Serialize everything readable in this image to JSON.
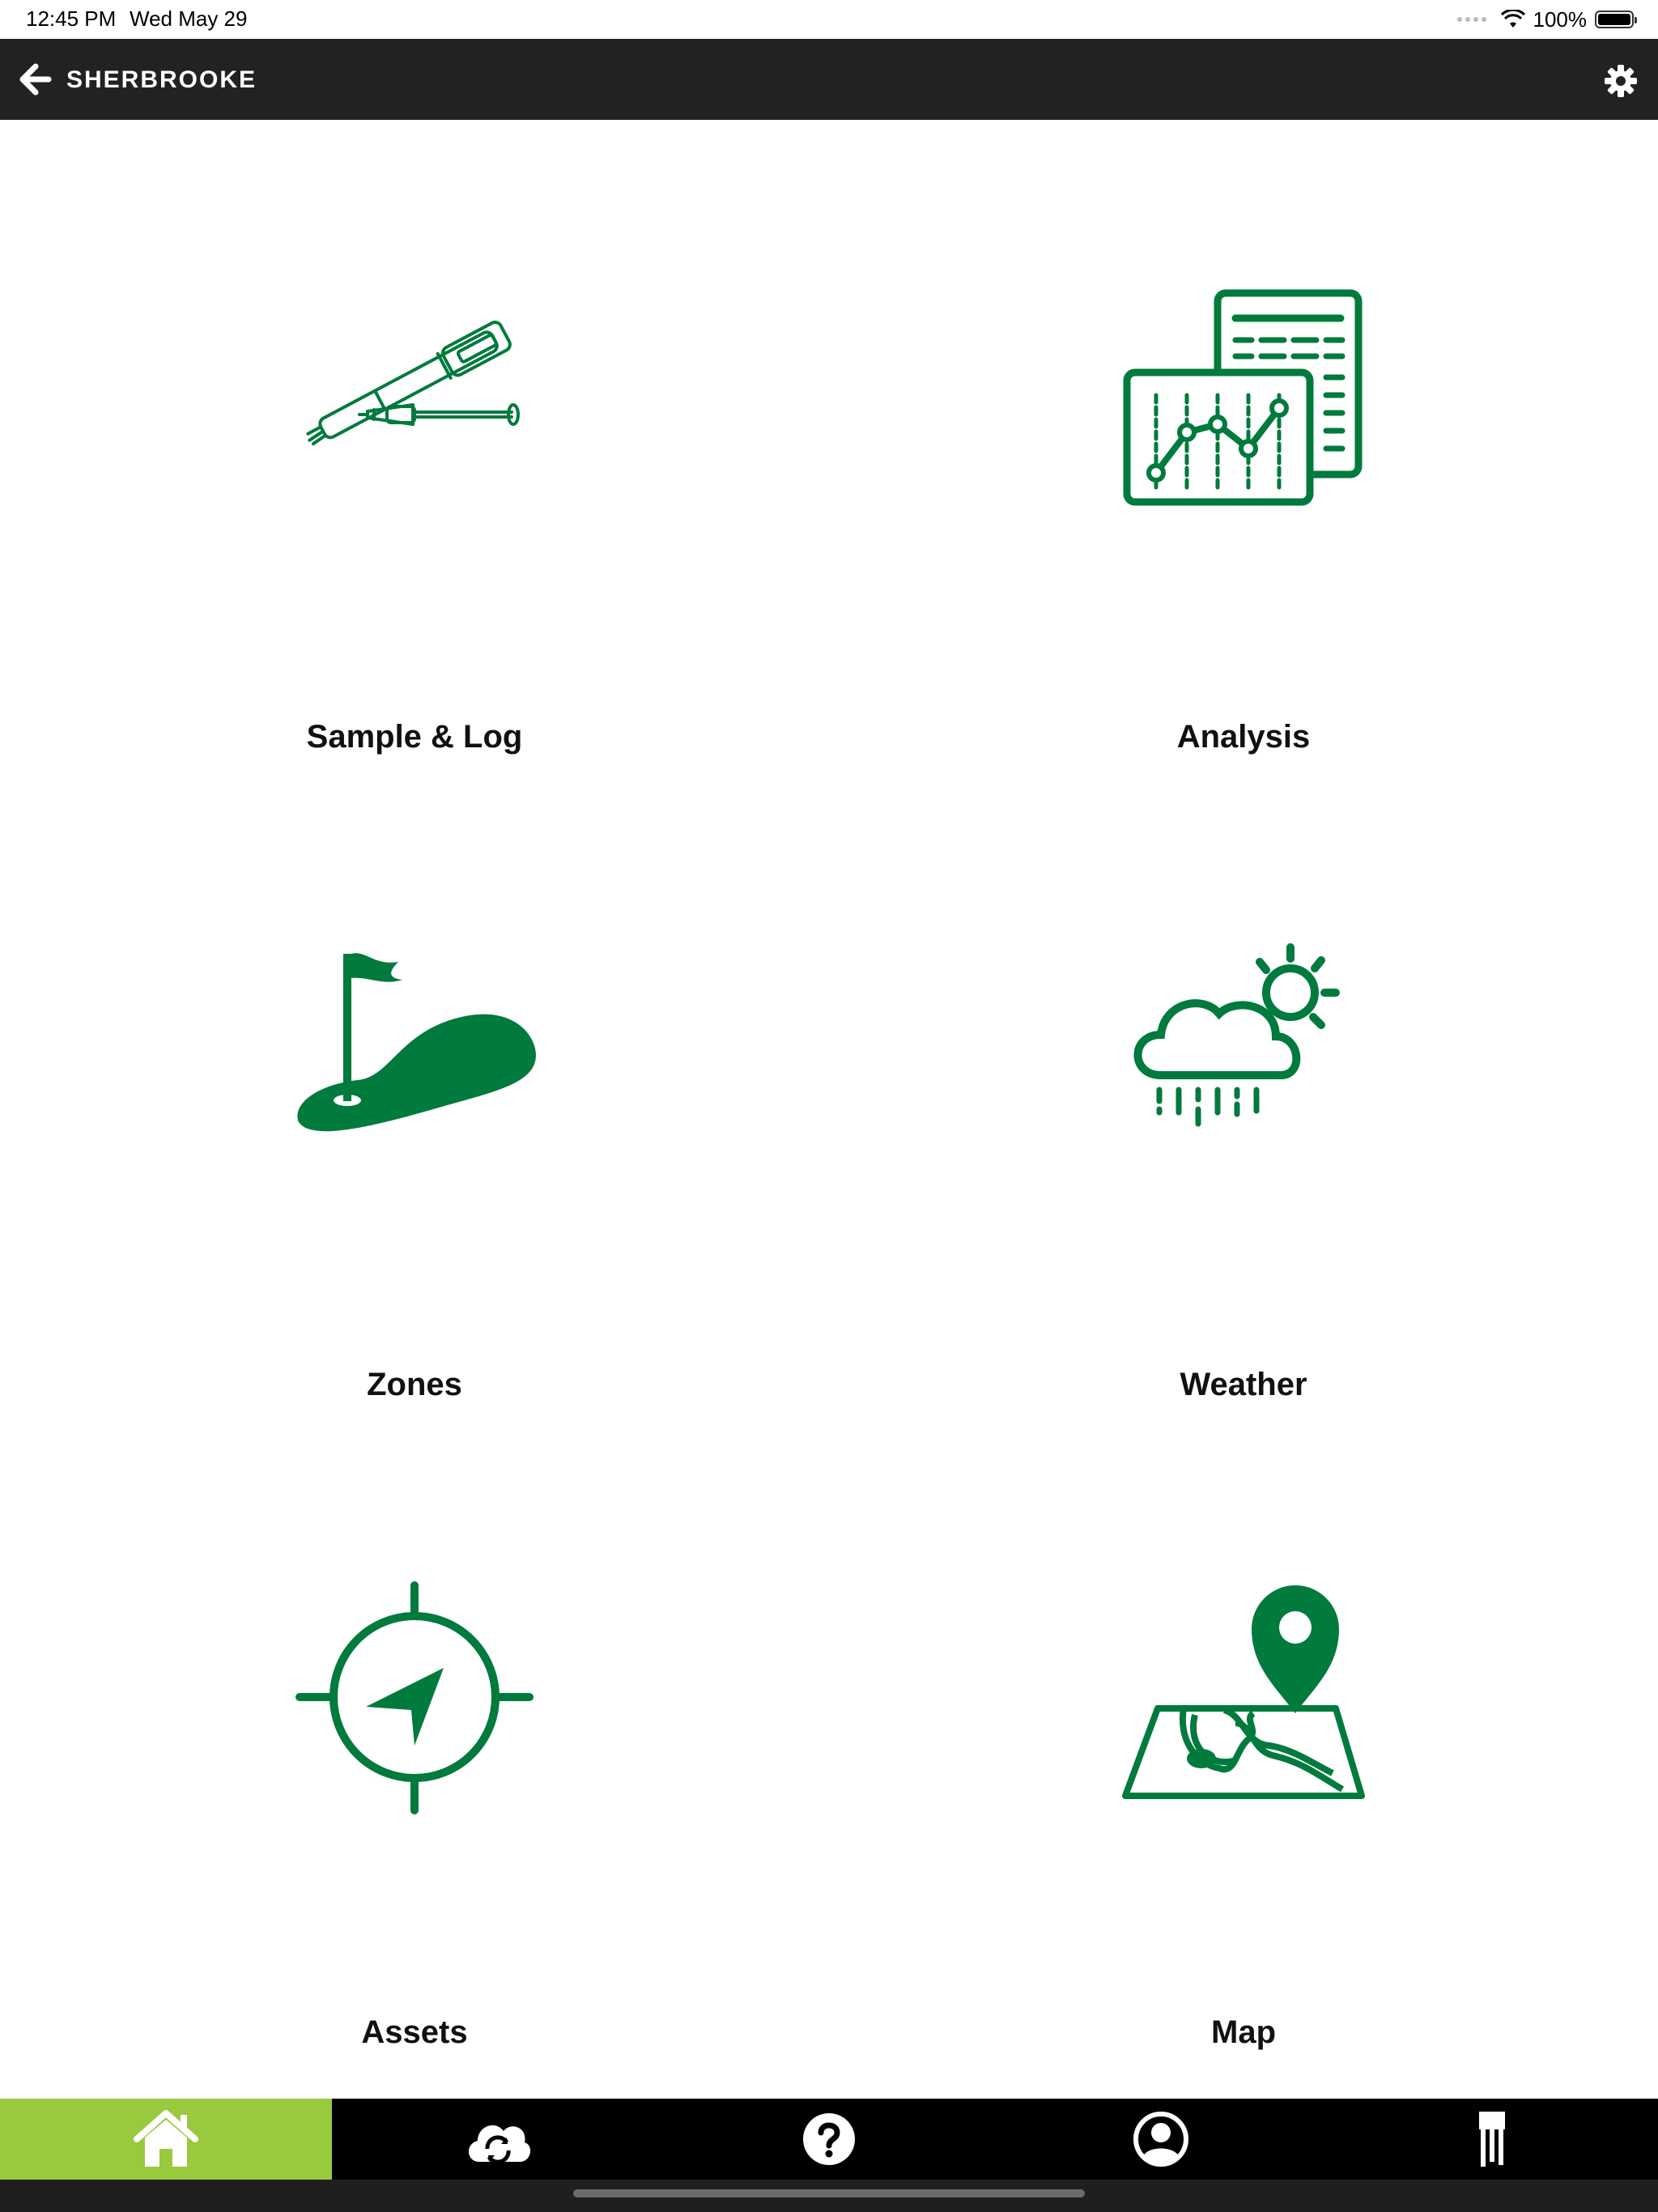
{
  "status_bar": {
    "time": "12:45 PM",
    "date": "Wed May 29",
    "battery": "100%"
  },
  "nav": {
    "title": "SHERBROOKE"
  },
  "colors": {
    "accent_green": "#007a3d",
    "tab_active": "#99c93d",
    "nav_bg": "#222222"
  },
  "tiles": [
    {
      "label": "Sample & Log",
      "icon": "probe-icon"
    },
    {
      "label": "Analysis",
      "icon": "analysis-chart-icon"
    },
    {
      "label": "Zones",
      "icon": "golf-green-icon"
    },
    {
      "label": "Weather",
      "icon": "cloud-rain-sun-icon"
    },
    {
      "label": "Assets",
      "icon": "compass-target-icon"
    },
    {
      "label": "Map",
      "icon": "map-pin-icon"
    }
  ],
  "tab_bar": {
    "active_index": 0,
    "tabs": [
      {
        "icon": "home-icon"
      },
      {
        "icon": "cloud-sync-icon"
      },
      {
        "icon": "help-icon"
      },
      {
        "icon": "profile-icon"
      },
      {
        "icon": "probe-tab-icon"
      }
    ]
  }
}
